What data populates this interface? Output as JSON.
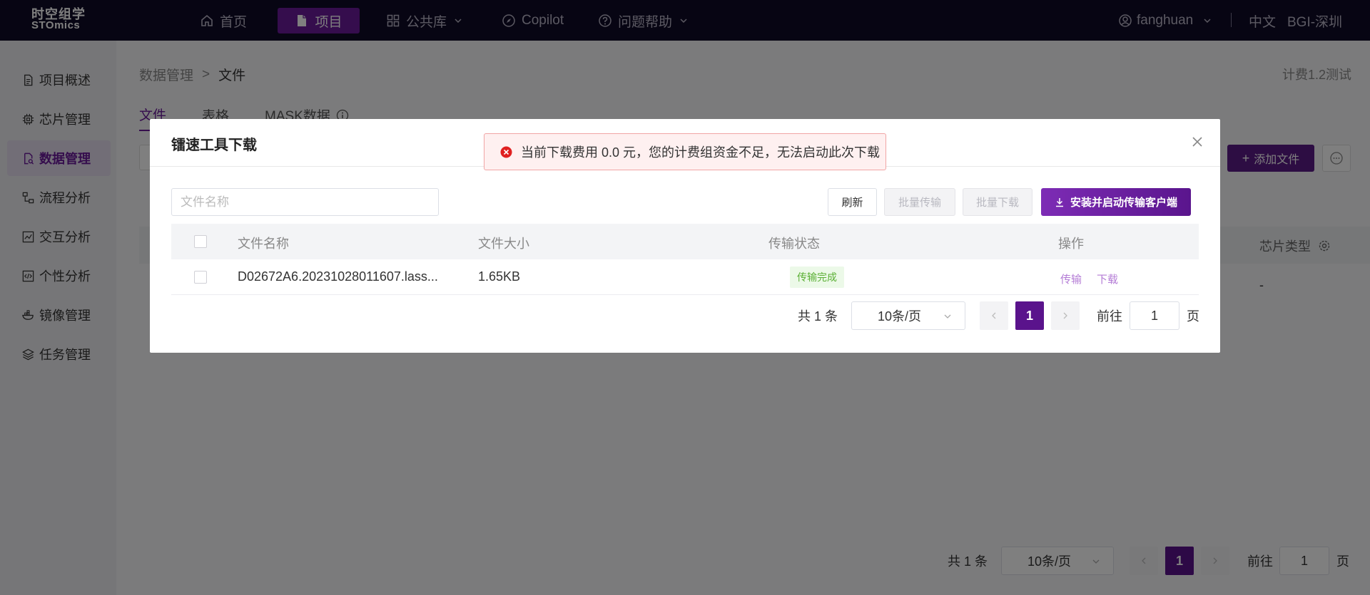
{
  "brand": {
    "line1": "时空组学",
    "line2": "STOmics"
  },
  "nav": {
    "home": "首页",
    "project": "项目",
    "library": "公共库",
    "copilot": "Copilot",
    "help": "问题帮助",
    "user": "fanghuan",
    "lang": "中文",
    "region": "BGI-深圳"
  },
  "sidebar": {
    "items": [
      {
        "label": "项目概述"
      },
      {
        "label": "芯片管理"
      },
      {
        "label": "数据管理"
      },
      {
        "label": "流程分析"
      },
      {
        "label": "交互分析"
      },
      {
        "label": "个性分析"
      },
      {
        "label": "镜像管理"
      },
      {
        "label": "任务管理"
      }
    ]
  },
  "page": {
    "breadcrumb": {
      "parent": "数据管理",
      "sep": ">",
      "current": "文件"
    },
    "billing": "计费1.2测试",
    "tabs": [
      "文件",
      "表格",
      "MASK数据"
    ],
    "add_file": "添加文件",
    "chip_type_header": "芯片类型",
    "chip_type_value": "-",
    "pager": {
      "total": "共 1 条",
      "size": "10条/页",
      "page": "1",
      "goto": "前往",
      "goto_value": "1",
      "unit": "页"
    }
  },
  "modal": {
    "title": "镭速工具下载",
    "search_placeholder": "文件名称",
    "buttons": {
      "refresh": "刷新",
      "batch_transfer": "批量传输",
      "batch_download": "批量下载",
      "install": "安装并启动传输客户端"
    },
    "columns": [
      "文件名称",
      "文件大小",
      "传输状态",
      "操作"
    ],
    "rows": [
      {
        "name": "D02672A6.20231028011607.lass...",
        "size": "1.65KB",
        "status": "传输完成",
        "op_transfer": "传输",
        "op_download": "下载"
      }
    ],
    "pager": {
      "total": "共 1 条",
      "size": "10条/页",
      "page": "1",
      "goto": "前往",
      "goto_value": "1",
      "unit": "页"
    }
  },
  "toast": {
    "message": "当前下载费用 0.0 元，您的计费组资金不足，无法启动此次下载"
  },
  "colors": {
    "primary": "#5a138c",
    "nav_bg": "#0f0a26",
    "success": "#5bb035",
    "error": "#e74c3c"
  }
}
